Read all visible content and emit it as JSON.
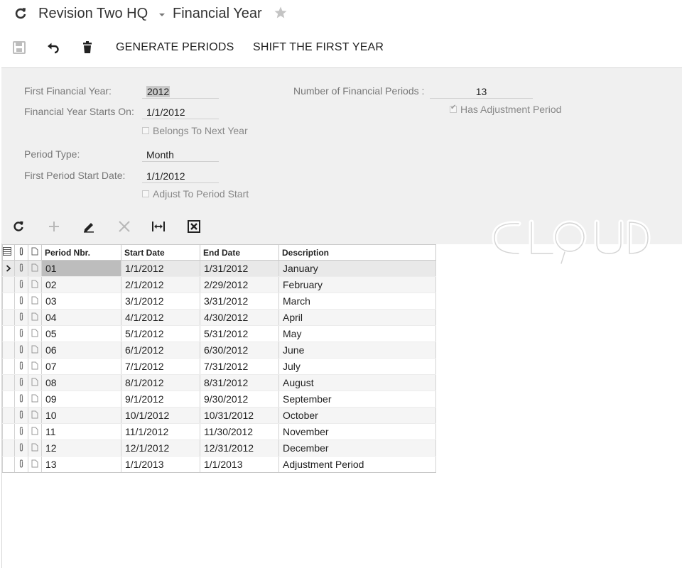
{
  "header": {
    "company": "Revision Two HQ",
    "screen_title": "Financial Year"
  },
  "toolbar": {
    "generate_periods": "GENERATE PERIODS",
    "shift_first_year": "SHIFT THE FIRST YEAR"
  },
  "form": {
    "first_financial_year_label": "First Financial Year:",
    "first_financial_year_value": "2012",
    "year_starts_on_label": "Financial Year Starts On:",
    "year_starts_on_value": "1/1/2012",
    "belongs_to_next_year_label": "Belongs To Next Year",
    "belongs_to_next_year_checked": false,
    "period_type_label": "Period Type:",
    "period_type_value": "Month",
    "first_period_start_label": "First Period Start Date:",
    "first_period_start_value": "1/1/2012",
    "adjust_to_period_start_label": "Adjust To Period Start",
    "adjust_to_period_start_checked": false,
    "num_periods_label": "Number of Financial Periods :",
    "num_periods_value": "13",
    "has_adjustment_label": "Has Adjustment Period",
    "has_adjustment_checked": true
  },
  "watermark_text": "CLOUD",
  "grid": {
    "columns": [
      "Period Nbr.",
      "Start Date",
      "End Date",
      "Description"
    ],
    "rows": [
      {
        "nbr": "01",
        "start": "1/1/2012",
        "end": "1/31/2012",
        "desc": "January"
      },
      {
        "nbr": "02",
        "start": "2/1/2012",
        "end": "2/29/2012",
        "desc": "February"
      },
      {
        "nbr": "03",
        "start": "3/1/2012",
        "end": "3/31/2012",
        "desc": "March"
      },
      {
        "nbr": "04",
        "start": "4/1/2012",
        "end": "4/30/2012",
        "desc": "April"
      },
      {
        "nbr": "05",
        "start": "5/1/2012",
        "end": "5/31/2012",
        "desc": "May"
      },
      {
        "nbr": "06",
        "start": "6/1/2012",
        "end": "6/30/2012",
        "desc": "June"
      },
      {
        "nbr": "07",
        "start": "7/1/2012",
        "end": "7/31/2012",
        "desc": "July"
      },
      {
        "nbr": "08",
        "start": "8/1/2012",
        "end": "8/31/2012",
        "desc": "August"
      },
      {
        "nbr": "09",
        "start": "9/1/2012",
        "end": "9/30/2012",
        "desc": "September"
      },
      {
        "nbr": "10",
        "start": "10/1/2012",
        "end": "10/31/2012",
        "desc": "October"
      },
      {
        "nbr": "11",
        "start": "11/1/2012",
        "end": "11/30/2012",
        "desc": "November"
      },
      {
        "nbr": "12",
        "start": "12/1/2012",
        "end": "12/31/2012",
        "desc": "December"
      },
      {
        "nbr": "13",
        "start": "1/1/2013",
        "end": "1/1/2013",
        "desc": "Adjustment Period"
      }
    ],
    "selected_row": 0
  },
  "icons": {
    "refresh": "refresh-icon",
    "caret": "chevron-down-icon",
    "favorite": "star-icon",
    "save": "save-icon",
    "undo": "undo-icon",
    "delete": "trash-icon",
    "grid_refresh": "refresh-icon",
    "grid_add": "plus-icon",
    "grid_edit": "pencil-icon",
    "grid_delete": "close-icon",
    "fit_columns": "fit-width-icon",
    "export_excel": "excel-export-icon"
  }
}
